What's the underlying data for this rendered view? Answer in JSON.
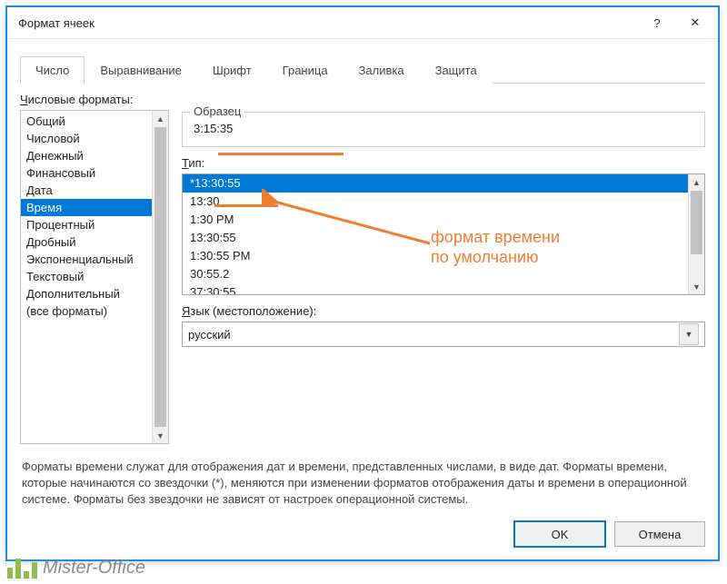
{
  "window": {
    "title": "Формат ячеек",
    "help_icon": "?",
    "close_icon": "✕"
  },
  "tabs": [
    "Число",
    "Выравнивание",
    "Шрифт",
    "Граница",
    "Заливка",
    "Защита"
  ],
  "active_tab": 0,
  "labels": {
    "categories": "Числовые форматы:",
    "sample": "Образец",
    "type": "Тип:",
    "language": "Язык (местоположение):"
  },
  "categories": [
    "Общий",
    "Числовой",
    "Денежный",
    "Финансовый",
    "Дата",
    "Время",
    "Процентный",
    "Дробный",
    "Экспоненциальный",
    "Текстовый",
    "Дополнительный",
    "(все форматы)"
  ],
  "category_selected": 5,
  "sample_value": "3:15:35",
  "types": [
    "*13:30:55",
    "13:30",
    "1:30 PM",
    "13:30:55",
    "1:30:55 PM",
    "30:55.2",
    "37:30:55"
  ],
  "type_selected": 0,
  "language_value": "русский",
  "help_text": "Форматы времени служат для отображения дат и времени, представленных числами, в виде дат. Форматы времени, которые начинаются со звездочки (*), меняются при изменении форматов отображения даты и времени в операционной системе. Форматы без звездочки не зависят от настроек операционной системы.",
  "buttons": {
    "ok": "OK",
    "cancel": "Отмена"
  },
  "annotation": {
    "line1": "формат времени",
    "line2": "по умолчанию"
  },
  "watermark": "Mister-Office"
}
